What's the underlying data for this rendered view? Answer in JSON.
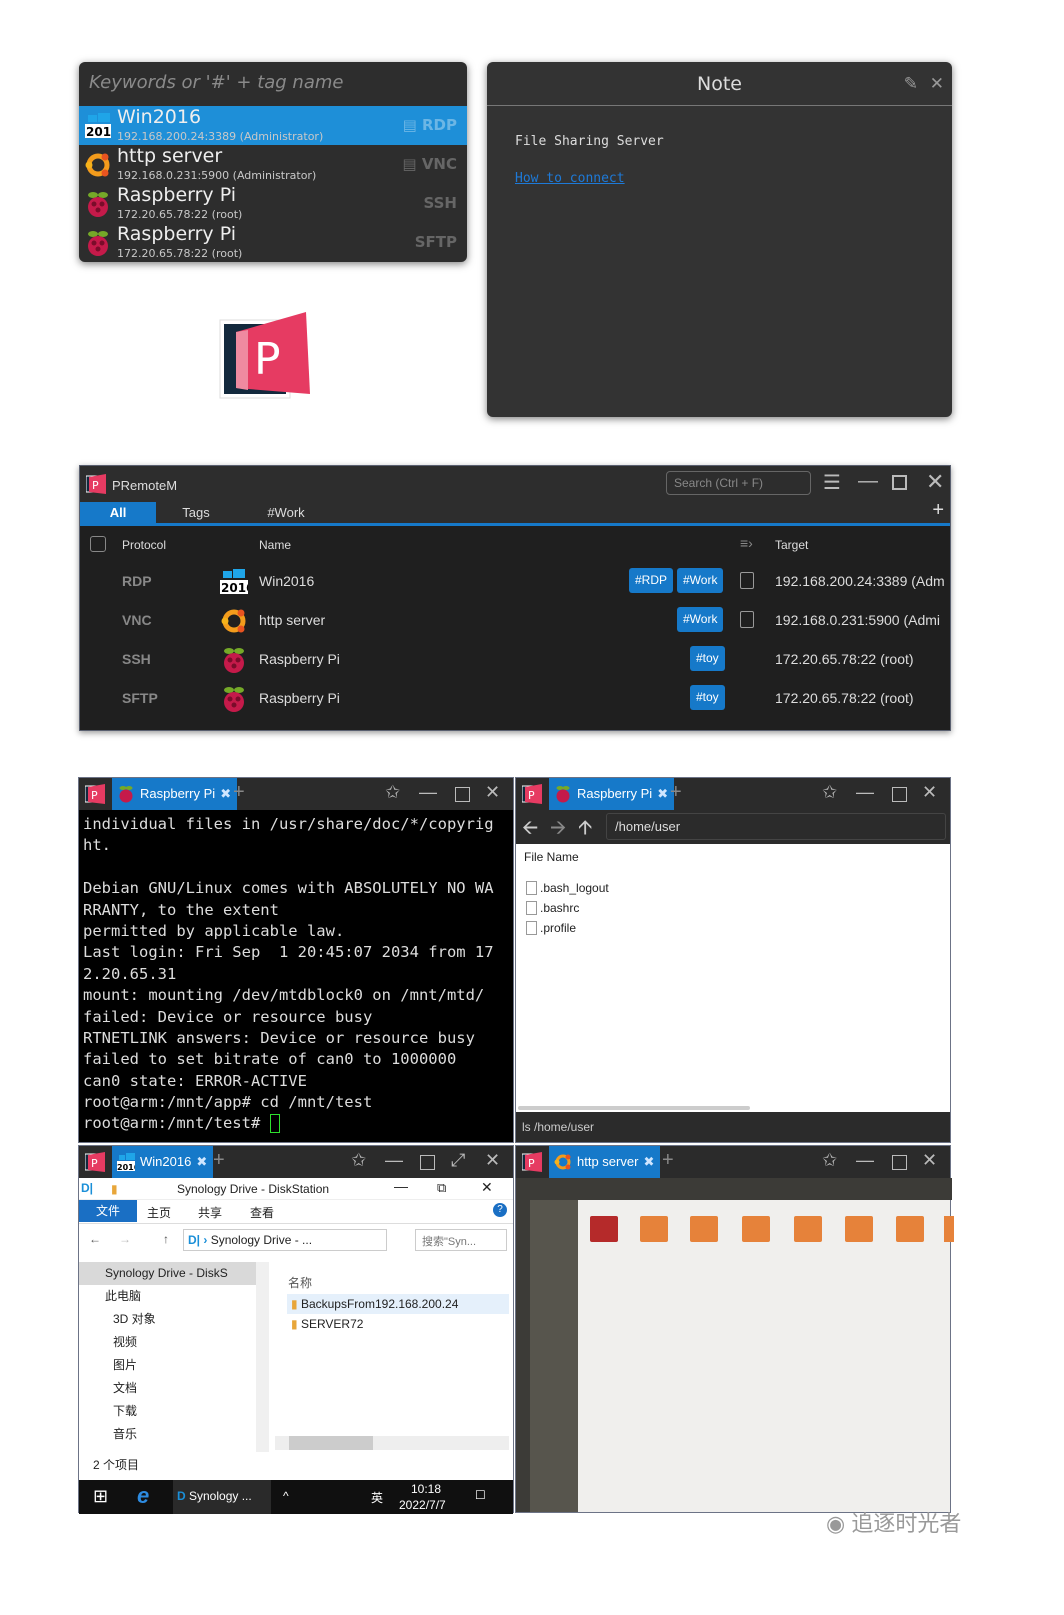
{
  "launcher": {
    "search_placeholder": "Keywords or '#' + tag name",
    "items": [
      {
        "name": "Win2016",
        "detail": "192.168.200.24:3389 (Administrator)",
        "protocol": "RDP",
        "icon": "windows-2016-icon",
        "has_note": true,
        "selected": true
      },
      {
        "name": "http server",
        "detail": "192.168.0.231:5900 (Administrator)",
        "protocol": "VNC",
        "icon": "ubuntu-icon",
        "has_note": true,
        "selected": false
      },
      {
        "name": "Raspberry Pi",
        "detail": "172.20.65.78:22 (root)",
        "protocol": "SSH",
        "icon": "raspberry-pi-icon",
        "has_note": false,
        "selected": false
      },
      {
        "name": "Raspberry Pi",
        "detail": "172.20.65.78:22 (root)",
        "protocol": "SFTP",
        "icon": "raspberry-pi-icon",
        "has_note": false,
        "selected": false
      }
    ]
  },
  "note": {
    "title": "Note",
    "text": "File Sharing Server",
    "link": "How to connect"
  },
  "logo": {
    "letter": "P",
    "label": "P"
  },
  "main_window": {
    "title": "PRemoteM",
    "search_placeholder": "Search (Ctrl + F)",
    "tabs": [
      "All",
      "Tags",
      "#Work"
    ],
    "active_tab": "All",
    "columns": {
      "protocol": "Protocol",
      "name": "Name",
      "target": "Target"
    },
    "rows": [
      {
        "protocol": "RDP",
        "name": "Win2016",
        "tags": [
          "#RDP",
          "#Work"
        ],
        "has_note": true,
        "target": "192.168.200.24:3389 (Adm"
      },
      {
        "protocol": "VNC",
        "name": "http server",
        "tags": [
          "#Work"
        ],
        "has_note": true,
        "target": "192.168.0.231:5900 (Admi"
      },
      {
        "protocol": "SSH",
        "name": "Raspberry Pi",
        "tags": [
          "#toy"
        ],
        "has_note": false,
        "target": "172.20.65.78:22 (root)"
      },
      {
        "protocol": "SFTP",
        "name": "Raspberry Pi",
        "tags": [
          "#toy"
        ],
        "has_note": false,
        "target": "172.20.65.78:22 (root)"
      }
    ]
  },
  "ssh_window": {
    "tab": "Raspberry Pi",
    "lines": [
      "individual files in /usr/share/doc/*/copyrig",
      "ht.",
      "",
      "Debian GNU/Linux comes with ABSOLUTELY NO WA",
      "RRANTY, to the extent",
      "permitted by applicable law.",
      "Last login: Fri Sep  1 20:45:07 2034 from 17",
      "2.20.65.31",
      "mount: mounting /dev/mtdblock0 on /mnt/mtd/",
      "failed: Device or resource busy",
      "RTNETLINK answers: Device or resource busy",
      "failed to set bitrate of can0 to 1000000",
      "can0 state: ERROR-ACTIVE",
      "root@arm:/mnt/app# cd /mnt/test"
    ],
    "prompt": "root@arm:/mnt/test# "
  },
  "sftp_window": {
    "tab": "Raspberry Pi",
    "path": "/home/user",
    "column": "File Name",
    "files": [
      ".bash_logout",
      ".bashrc",
      ".profile"
    ],
    "status": "ls /home/user"
  },
  "rdp_window": {
    "tab": "Win2016",
    "explorer_title": "Synology Drive - DiskStation",
    "ribbon_tabs": [
      "文件",
      "主页",
      "共享",
      "查看"
    ],
    "address": "Synology Drive - ...",
    "search_placeholder": "搜索\"Syn...",
    "nav_items": [
      "Synology Drive - DiskS",
      "此电脑",
      "3D 对象",
      "视频",
      "图片",
      "文档",
      "下载",
      "音乐"
    ],
    "column": "名称",
    "files": [
      "BackupsFrom192.168.200.24",
      "SERVER72"
    ],
    "status": "2 个项目",
    "taskbar": {
      "app": "Synology ...",
      "ime": "英",
      "time": "10:18",
      "date": "2022/7/7"
    }
  },
  "vnc_window": {
    "tab": "http server"
  },
  "watermark": "追逐时光者"
}
